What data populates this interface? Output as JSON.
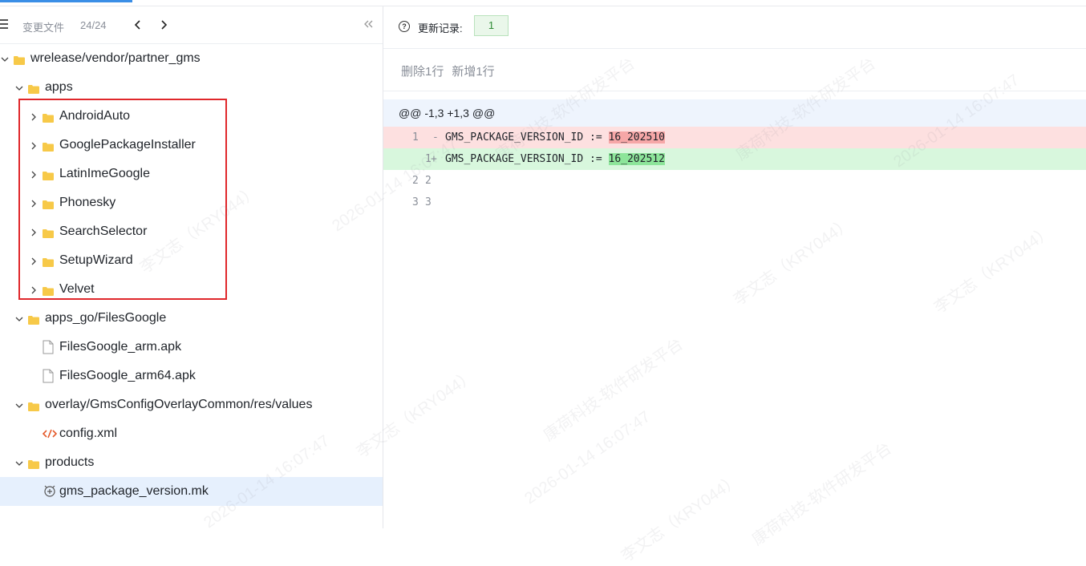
{
  "left": {
    "title": "变更文件",
    "count": "24/24",
    "tree": [
      {
        "label": "wrelease/vendor/partner_gms",
        "type": "folder",
        "depth": 0,
        "expanded": true
      },
      {
        "label": "apps",
        "type": "folder",
        "depth": 1,
        "expanded": true
      },
      {
        "label": "AndroidAuto",
        "type": "folder",
        "depth": 2,
        "expanded": false
      },
      {
        "label": "GooglePackageInstaller",
        "type": "folder",
        "depth": 2,
        "expanded": false
      },
      {
        "label": "LatinImeGoogle",
        "type": "folder",
        "depth": 2,
        "expanded": false
      },
      {
        "label": "Phonesky",
        "type": "folder",
        "depth": 2,
        "expanded": false
      },
      {
        "label": "SearchSelector",
        "type": "folder",
        "depth": 2,
        "expanded": false
      },
      {
        "label": "SetupWizard",
        "type": "folder",
        "depth": 2,
        "expanded": false
      },
      {
        "label": "Velvet",
        "type": "folder",
        "depth": 2,
        "expanded": false
      },
      {
        "label": "apps_go/FilesGoogle",
        "type": "folder",
        "depth": 1,
        "expanded": true
      },
      {
        "label": "FilesGoogle_arm.apk",
        "type": "file",
        "depth": 2
      },
      {
        "label": "FilesGoogle_arm64.apk",
        "type": "file",
        "depth": 2
      },
      {
        "label": "overlay/GmsConfigOverlayCommon/res/values",
        "type": "folder",
        "depth": 1,
        "expanded": true
      },
      {
        "label": "config.xml",
        "type": "xml",
        "depth": 2
      },
      {
        "label": "products",
        "type": "folder",
        "depth": 1,
        "expanded": true
      },
      {
        "label": "gms_package_version.mk",
        "type": "mk",
        "depth": 2,
        "selected": true
      }
    ]
  },
  "right": {
    "history_label": "更新记录:",
    "revision": "1",
    "summary_deleted": "删除1行",
    "summary_added": "新增1行",
    "hunk": "@@ -1,3 +1,3 @@",
    "lines": [
      {
        "kind": "del",
        "old": "1",
        "new": "",
        "mark": "-",
        "prefix": "GMS_PACKAGE_VERSION_ID := ",
        "changed": "16_202510"
      },
      {
        "kind": "add",
        "old": "",
        "new": "1",
        "mark": "+",
        "prefix": "GMS_PACKAGE_VERSION_ID := ",
        "changed": "16_202512"
      },
      {
        "kind": "ctx",
        "old": "2",
        "new": "2",
        "mark": "",
        "prefix": "",
        "changed": ""
      },
      {
        "kind": "ctx",
        "old": "3",
        "new": "3",
        "mark": "",
        "prefix": "",
        "changed": ""
      }
    ]
  },
  "watermark": {
    "name": "李文志（KRY044）",
    "date": "2026-01-14 16:07:47",
    "platform": "康荷科技-软件研发平台"
  },
  "colors": {
    "accent": "#3a8ee6",
    "highlight_box": "#e0272b",
    "selected_row": "#e6f0fd",
    "folder": "#f7c948",
    "del_bg": "#fde0e0",
    "add_bg": "#d8f7dd"
  }
}
